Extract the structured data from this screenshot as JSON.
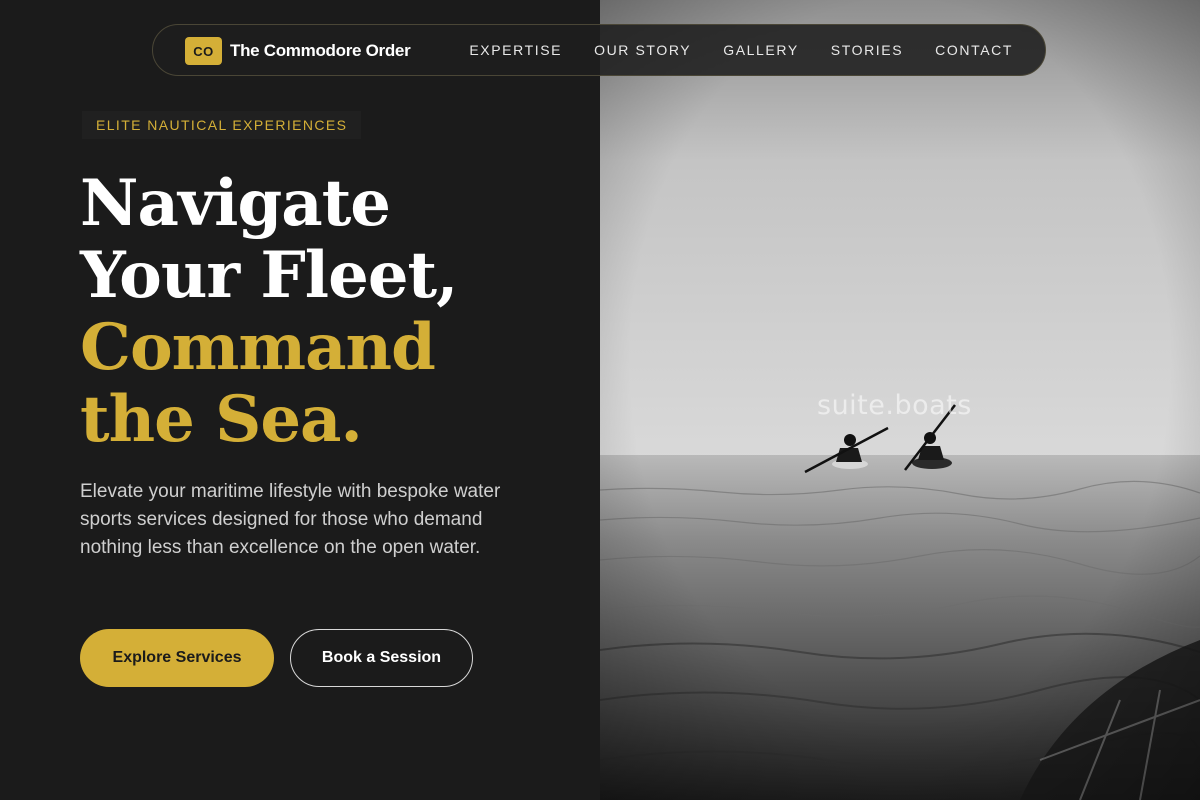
{
  "brand": {
    "logo_text": "CO",
    "name": "The Commodore Order"
  },
  "nav": {
    "links": [
      "EXPERTISE",
      "OUR STORY",
      "GALLERY",
      "STORIES",
      "CONTACT"
    ]
  },
  "hero": {
    "eyebrow": "ELITE NAUTICAL EXPERIENCES",
    "headline_lines": [
      "Navigate",
      "Your Fleet,",
      "Command",
      "the Sea."
    ],
    "description": "Elevate your maritime lifestyle with bespoke water sports services designed for those who demand nothing less than excellence on the open water.",
    "primary_cta": "Explore Services",
    "secondary_cta": "Book a Session"
  },
  "photo": {
    "watermark": "suite.boats"
  },
  "colors": {
    "accent": "#d4af37",
    "background": "#1b1b1b",
    "text_primary": "#ffffff",
    "text_muted": "#cfcfcf"
  }
}
